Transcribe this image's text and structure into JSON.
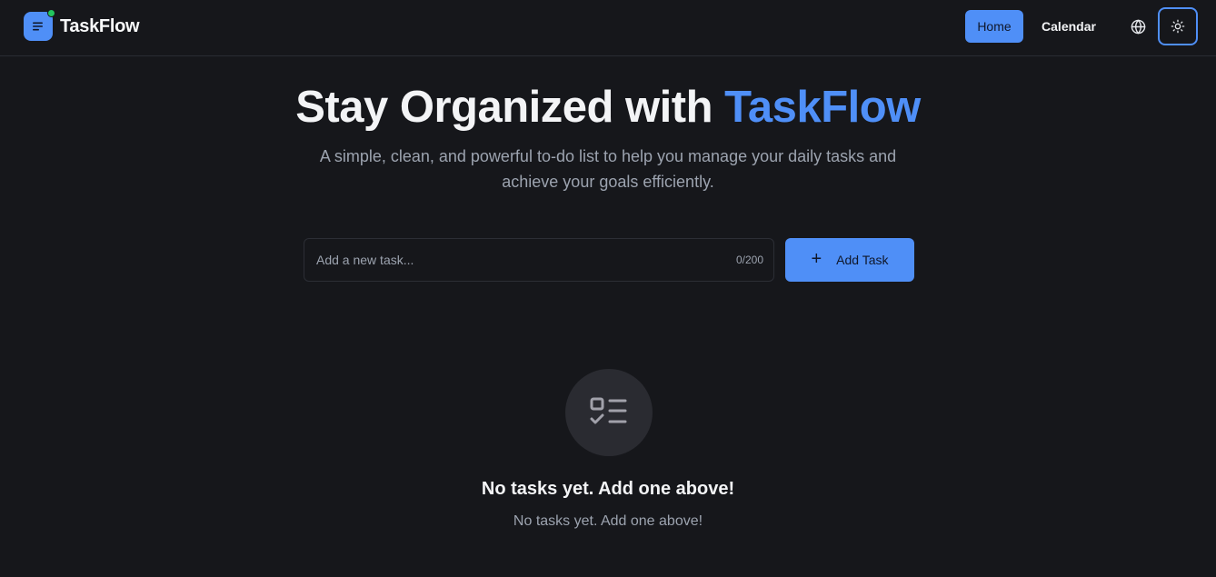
{
  "header": {
    "brand_name": "TaskFlow",
    "logo_icon": "menu-lines-icon",
    "nav": {
      "home_label": "Home",
      "calendar_label": "Calendar"
    },
    "language_icon": "globe-icon",
    "theme_icon": "sun-icon"
  },
  "hero": {
    "title_prefix": "Stay Organized with ",
    "title_accent": "TaskFlow",
    "subtitle": "A simple, clean, and powerful to-do list to help you manage your daily tasks and achieve your goals efficiently."
  },
  "task_form": {
    "input_value": "",
    "input_placeholder": "Add a new task...",
    "counter": "0/200",
    "add_button_label": "Add Task"
  },
  "empty_state": {
    "icon": "checklist-icon",
    "title": "No tasks yet. Add one above!",
    "subtitle": "No tasks yet. Add one above!"
  },
  "colors": {
    "background": "#16171b",
    "accent": "#4f8ff7",
    "status_dot": "#22c55e",
    "muted_text": "#9ca3af"
  }
}
